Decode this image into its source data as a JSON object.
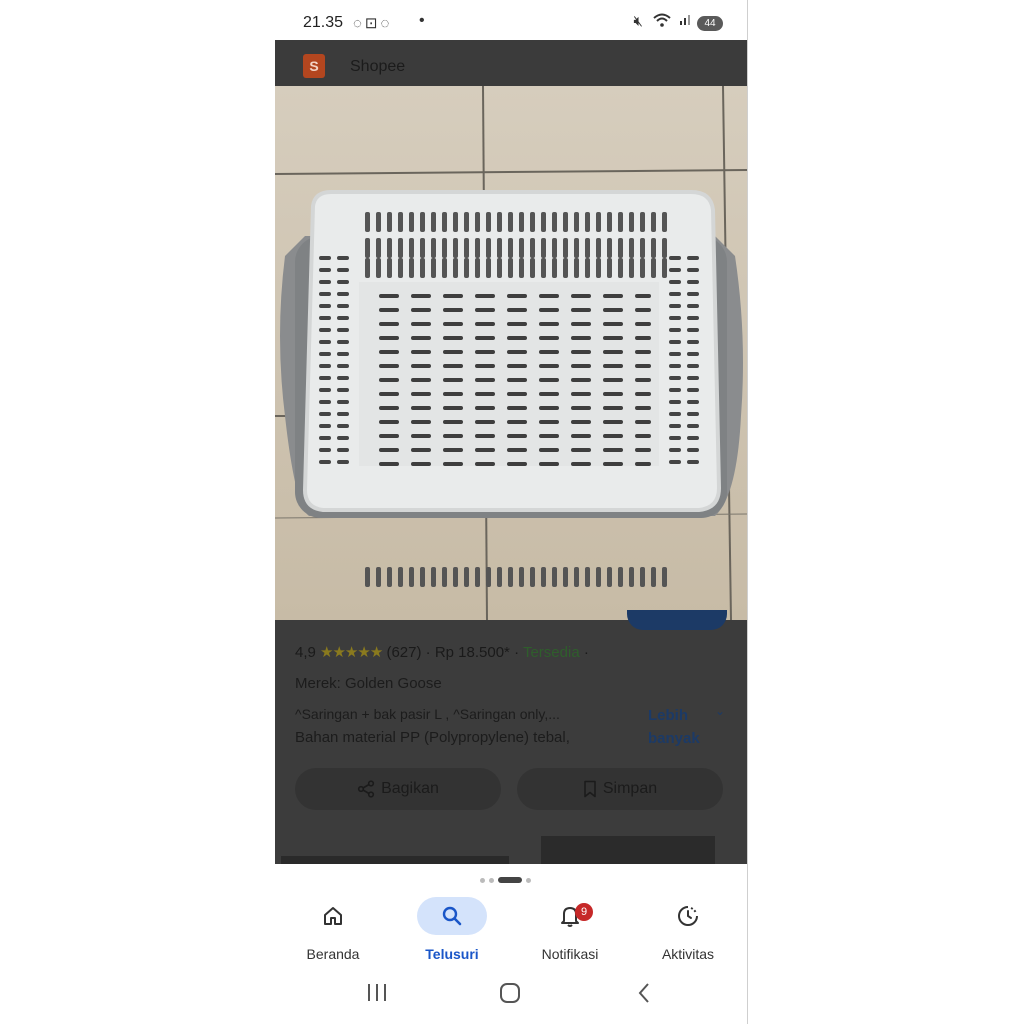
{
  "status_bar": {
    "time": "21.35",
    "left_icons": [
      "whatsapp-icon",
      "screenshot-icon",
      "whatsapp-icon"
    ],
    "dot": "•",
    "battery": "44"
  },
  "header": {
    "logo_letter": "S",
    "title": "Shopee"
  },
  "product": {
    "rating": "4,9",
    "stars": "★★★★★",
    "reviews": "(627)",
    "price": "Rp 18.500*",
    "availability": "Tersedia",
    "separator": "·",
    "brand": "Merek: Golden Goose",
    "desc_line1": "^Saringan + bak pasir L , ^Saringan only,...",
    "desc_line2": "Bahan material PP (Polypropylene) tebal,",
    "more_label_1": "Lebih",
    "more_label_2": "banyak"
  },
  "actions": {
    "share_label": "Bagikan",
    "save_label": "Simpan"
  },
  "bottom_nav": {
    "items": [
      {
        "label": "Beranda",
        "icon": "home-icon"
      },
      {
        "label": "Telusuri",
        "icon": "search-icon"
      },
      {
        "label": "Notifikasi",
        "icon": "bell-icon"
      },
      {
        "label": "Aktivitas",
        "icon": "activity-icon"
      }
    ],
    "notification_count": "9",
    "active": "Telusuri"
  },
  "colors": {
    "accent": "#1a56c8",
    "active_pill": "#d4e3fb",
    "badge": "#c62828",
    "overlay": "#3a3a3a"
  }
}
